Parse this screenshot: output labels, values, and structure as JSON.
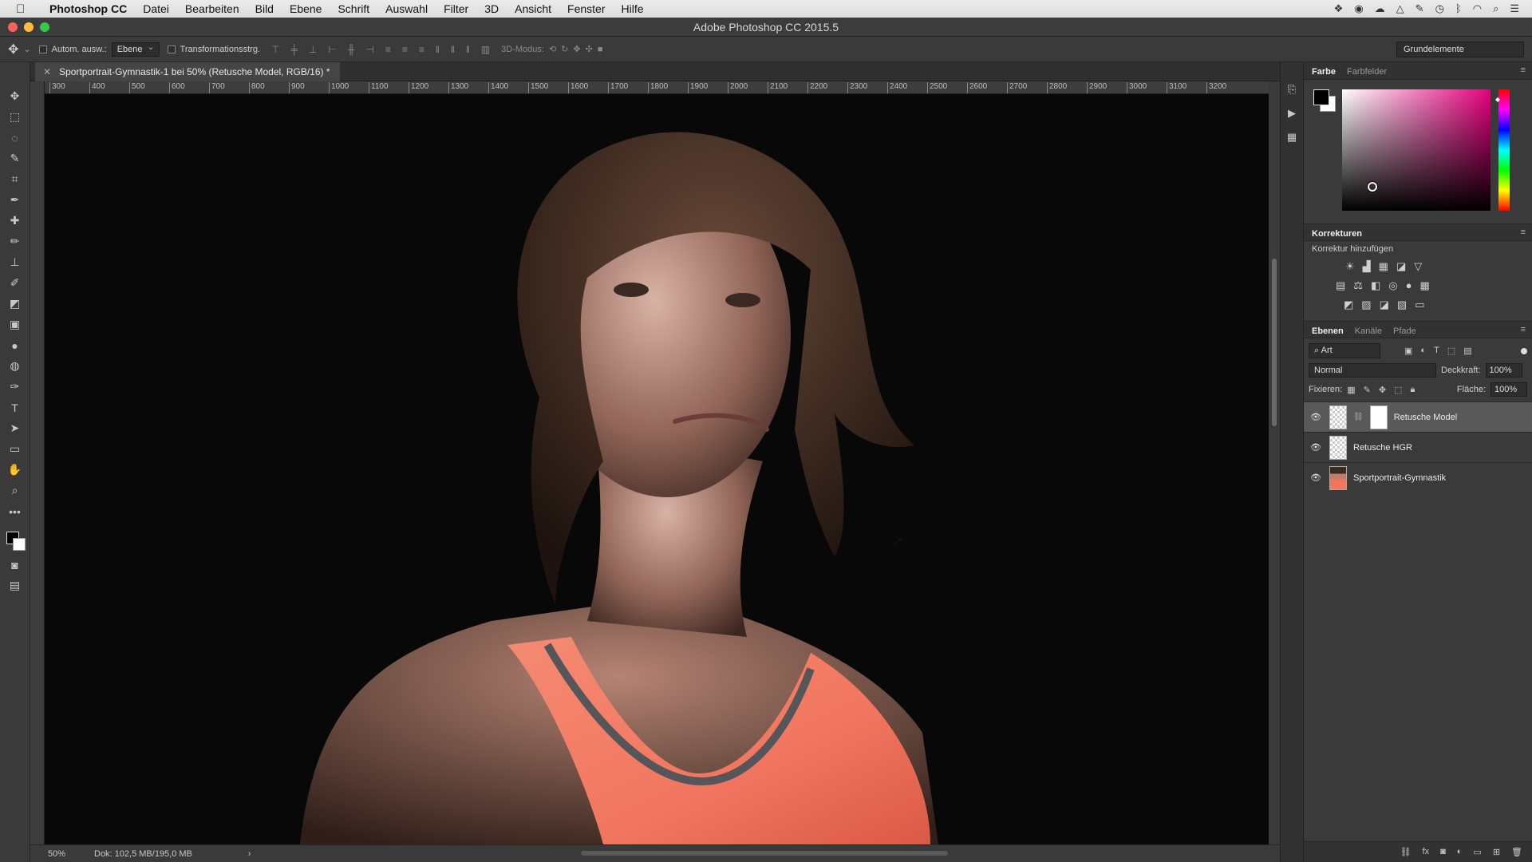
{
  "menubar": {
    "app_name": "Photoshop CC",
    "items": [
      "Datei",
      "Bearbeiten",
      "Bild",
      "Ebene",
      "Schrift",
      "Auswahl",
      "Filter",
      "3D",
      "Ansicht",
      "Fenster",
      "Hilfe"
    ]
  },
  "window": {
    "title": "Adobe Photoshop CC 2015.5"
  },
  "options_bar": {
    "auto_select_label": "Autom. ausw.:",
    "auto_select_target": "Ebene",
    "transform_controls_label": "Transformationsstrg.",
    "mode_3d_label": "3D-Modus:",
    "workspace": "Grundelemente"
  },
  "document": {
    "tab_title": "Sportportrait-Gymnastik-1 bei 50% (Retusche Model, RGB/16) *",
    "ruler_ticks": [
      "300",
      "400",
      "500",
      "600",
      "700",
      "800",
      "900",
      "1000",
      "1100",
      "1200",
      "1300",
      "1400",
      "1500",
      "1600",
      "1700",
      "1800",
      "1900",
      "2000",
      "2100",
      "2200",
      "2300",
      "2400",
      "2500",
      "2600",
      "2700",
      "2800",
      "2900",
      "3000",
      "3100",
      "3200"
    ]
  },
  "status_bar": {
    "zoom": "50%",
    "doc_info": "Dok: 102,5 MB/195,0 MB",
    "arrow": "›"
  },
  "color_panel": {
    "tabs": [
      "Farbe",
      "Farbfelder"
    ],
    "foreground": "#000000",
    "background": "#ffffff"
  },
  "adjustments_panel": {
    "title": "Korrekturen",
    "subtitle": "Korrektur hinzufügen"
  },
  "layers_panel": {
    "tabs": [
      "Ebenen",
      "Kanäle",
      "Pfade"
    ],
    "filter_label": "Art",
    "blend_mode": "Normal",
    "opacity_label": "Deckkraft:",
    "opacity_value": "100%",
    "lock_label": "Fixieren:",
    "fill_label": "Fläche:",
    "fill_value": "100%",
    "layers": [
      {
        "name": "Retusche Model",
        "visible": true,
        "selected": true,
        "has_mask": true
      },
      {
        "name": "Retusche HGR",
        "visible": true,
        "selected": false,
        "has_mask": false
      },
      {
        "name": "Sportportrait-Gymnastik",
        "visible": true,
        "selected": false,
        "has_mask": false
      }
    ]
  },
  "colors": {
    "top_color": "#f2765f",
    "ui_dark": "#3a3a3a",
    "canvas_bg": "#080808"
  }
}
